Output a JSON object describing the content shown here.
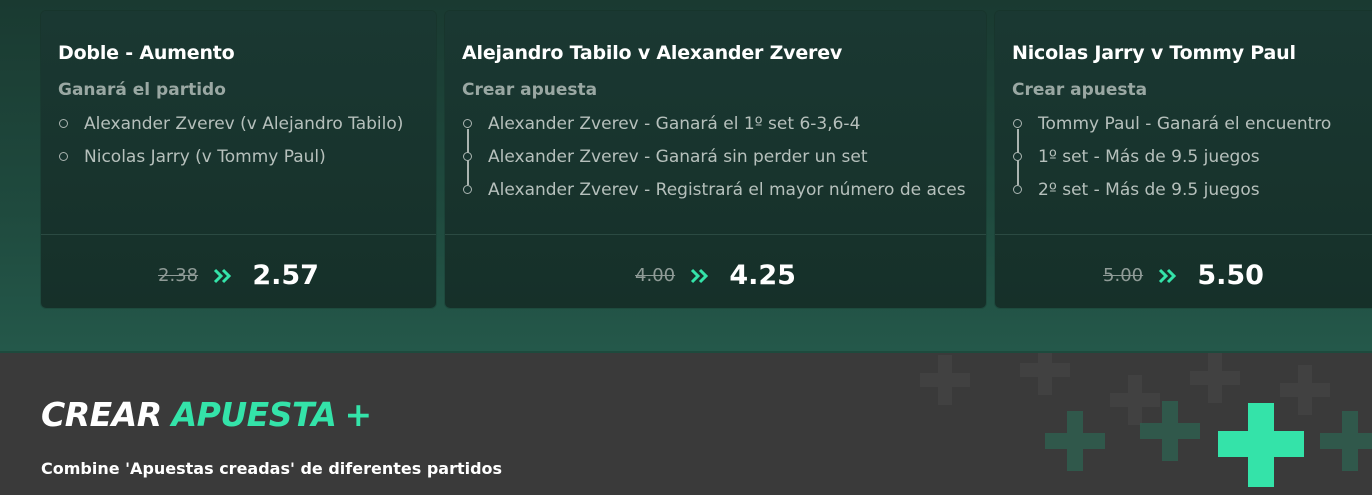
{
  "cards": [
    {
      "title": "Doble - Aumento",
      "subtitle": "Ganará el partido",
      "selections": [
        "Alexander Zverev (v Alejandro Tabilo)",
        "Nicolas Jarry (v Tommy Paul)"
      ],
      "old_odds": "2.38",
      "new_odds": "2.57"
    },
    {
      "title": "Alejandro Tabilo v Alexander Zverev",
      "subtitle": "Crear apuesta",
      "selections": [
        "Alexander Zverev - Ganará el 1º set 6-3,6-4",
        "Alexander Zverev - Ganará sin perder un set",
        "Alexander Zverev - Registrará el mayor número de aces"
      ],
      "old_odds": "4.00",
      "new_odds": "4.25"
    },
    {
      "title": "Nicolas Jarry v Tommy Paul",
      "subtitle": "Crear apuesta",
      "selections": [
        "Tommy Paul - Ganará el encuentro",
        "1º set - Más de 9.5 juegos",
        "2º set - Más de 9.5 juegos"
      ],
      "old_odds": "5.00",
      "new_odds": "5.50"
    }
  ],
  "banner": {
    "title_white": "CREAR",
    "title_green": "APUESTA",
    "title_plus": "+",
    "description": "Combine 'Apuestas creadas' de diferentes partidos"
  },
  "colors": {
    "accent": "#34e3a9",
    "card_bg": "#1a3832",
    "banner_bg": "#3a3a3a"
  },
  "icons": [
    "double-chevron-right-icon",
    "plus-icon",
    "selection-dot-icon"
  ]
}
